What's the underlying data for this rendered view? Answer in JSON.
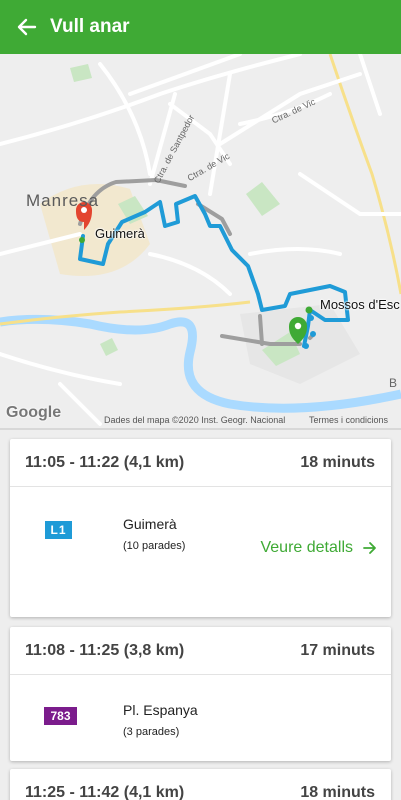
{
  "header": {
    "title": "Vull anar",
    "back_icon": "arrow-left-icon",
    "color": "#3faa35"
  },
  "map": {
    "city": "Manresa",
    "origin_stop": "Guimerà",
    "destination_stop": "Mossos d'Esc",
    "roads": [
      "Ctra. de Vic",
      "Ctra. de Santpedor",
      "Ctra. de Vic"
    ],
    "edge_letter": "B",
    "google": "Google",
    "attribution": "Dades del mapa ©2020 Inst. Geogr. Nacional",
    "terms": "Termes i condicions",
    "route_color": "#1f9bd7",
    "walk_color": "#9e9e9e"
  },
  "routes": [
    {
      "time_range": "11:05 - 11:22 (4,1 km)",
      "duration": "18 minuts",
      "line": "L1",
      "line_color": "#1f9bd7",
      "destination": "Guimerà",
      "stops": "(10 parades)",
      "details_label": "Veure detalls",
      "details_icon": "arrow-right-icon"
    },
    {
      "time_range": "11:08 - 11:25 (3,8 km)",
      "duration": "17 minuts",
      "line": "783",
      "line_color": "#7b1c8c",
      "destination": "Pl. Espanya",
      "stops": "(3 parades)"
    },
    {
      "time_range": "11:25 - 11:42 (4,1 km)",
      "duration": "18 minuts"
    }
  ]
}
